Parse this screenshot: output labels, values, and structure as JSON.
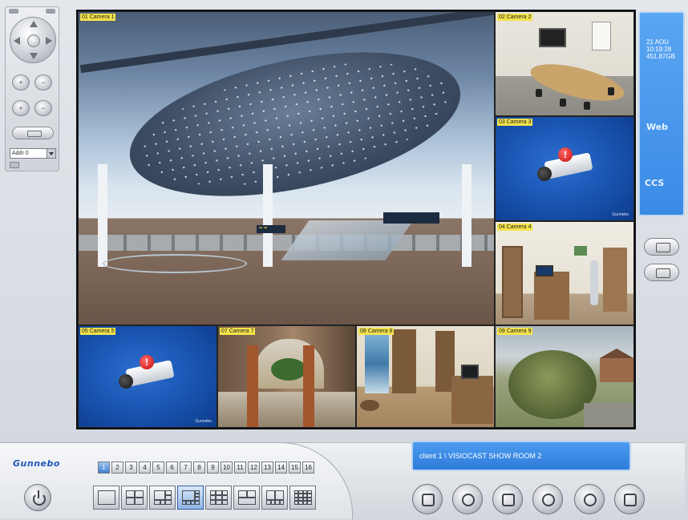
{
  "left_panel": {
    "address_select": "Addr 0"
  },
  "cameras": [
    {
      "label": "01 Camera 1"
    },
    {
      "label": "02 Camera 2"
    },
    {
      "label": "03 Camera 3"
    },
    {
      "label": "04 Camera 4"
    },
    {
      "label": "05 Camera 5"
    },
    {
      "label": "07 Camera 7"
    },
    {
      "label": "08 Camera 8"
    },
    {
      "label": "09 Camera 9"
    }
  ],
  "offline_brand": "Gunnebo",
  "info_panel": {
    "date": "21 AOU",
    "time": "10:19:28",
    "disk": "451.87GB",
    "web_label": "Web",
    "ccs_label": "CCS"
  },
  "brand": {
    "logo_text": "Gunnebo",
    "accent_color": "#1f58b8"
  },
  "channel_buttons": [
    "1",
    "2",
    "3",
    "4",
    "5",
    "6",
    "7",
    "8",
    "9",
    "10",
    "11",
    "12",
    "13",
    "14",
    "15",
    "16"
  ],
  "active_channel": "1",
  "layouts": [
    {
      "name": "1x1"
    },
    {
      "name": "2x2"
    },
    {
      "name": "1+5"
    },
    {
      "name": "1+7"
    },
    {
      "name": "3x3"
    },
    {
      "name": "1+12"
    },
    {
      "name": "2+8"
    },
    {
      "name": "4x4"
    }
  ],
  "active_layout": "1+7",
  "status_bar": {
    "text": "client 1 \\ VISIOCAST SHOW ROOM 2"
  },
  "bottom_icons": [
    "recorder-icon",
    "playback-icon",
    "tools-icon",
    "search-icon",
    "network-icon",
    "config-icon"
  ]
}
